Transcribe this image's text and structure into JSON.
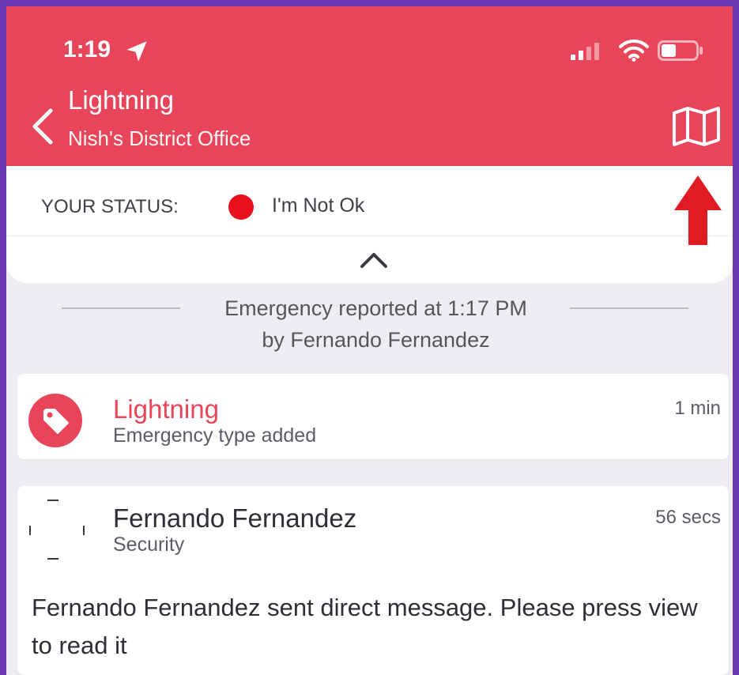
{
  "status_bar": {
    "time": "1:19"
  },
  "header": {
    "title": "Lightning",
    "subtitle": "Nish's District Office"
  },
  "status": {
    "label": "YOUR STATUS:",
    "value": "I'm Not Ok",
    "dot_color": "#e8101e"
  },
  "emergency": {
    "reported_line1": "Emergency reported at 1:17 PM",
    "reported_line2": "by Fernando Fernandez"
  },
  "feed": {
    "items": [
      {
        "title": "Lightning",
        "subtitle": "Emergency type added",
        "time": "1 min",
        "icon": "tag-icon"
      },
      {
        "name": "Fernando Fernandez",
        "role": "Security",
        "time": "56 secs",
        "message": "Fernando Fernandez sent direct message. Please press view to read it",
        "icon": "avatar"
      }
    ]
  },
  "colors": {
    "brand": "#e9455a",
    "background": "#eeeef2",
    "frame": "#6a3ab2",
    "annotation_arrow": "#e01b24"
  }
}
